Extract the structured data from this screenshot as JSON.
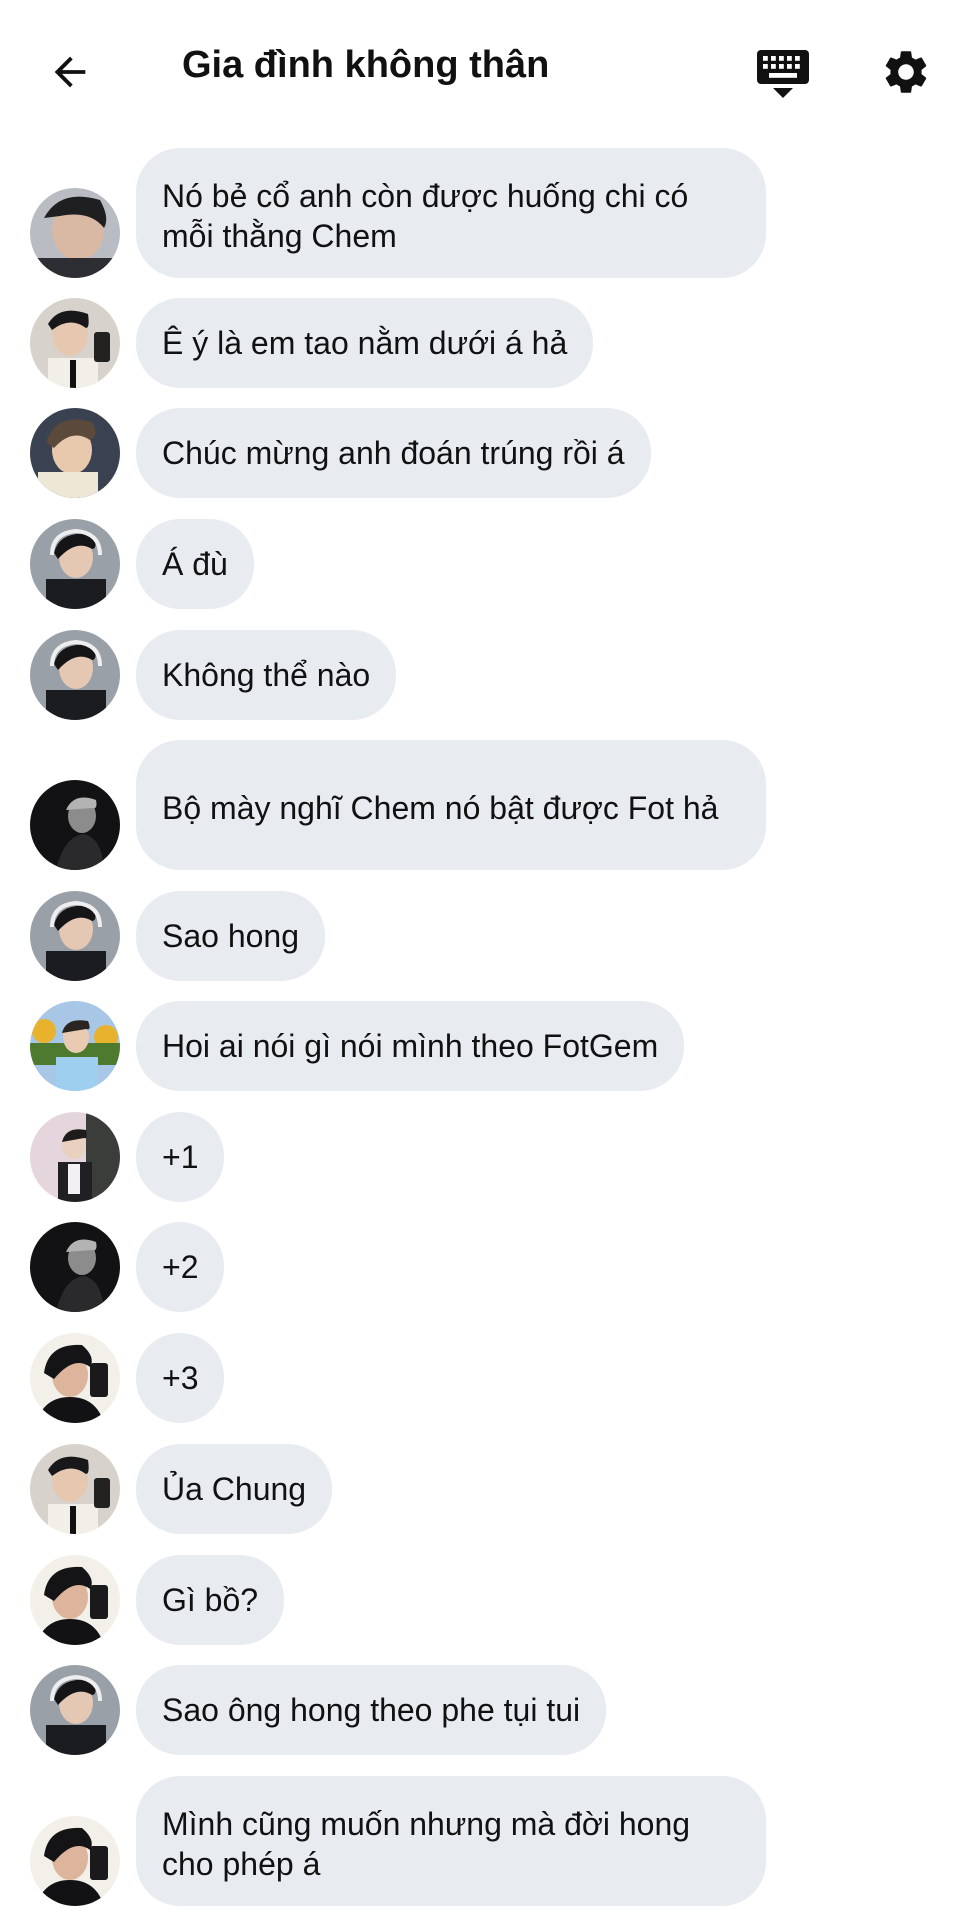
{
  "header": {
    "title": "Gia đình không thân",
    "back_icon": "arrow-left-icon",
    "keyboard_icon": "keyboard-hide-icon",
    "settings_icon": "gear-icon"
  },
  "colors": {
    "bubble_bg": "#e8ebf0",
    "text": "#111111",
    "background": "#ffffff"
  },
  "messages": [
    {
      "text": "Nó bẻ cổ anh còn được huống chi có mỗi thằng Chem"
    },
    {
      "text": "Ê ý là em tao nằm dưới á hả"
    },
    {
      "text": "Chúc mừng anh đoán trúng rồi á"
    },
    {
      "text": "Á đù"
    },
    {
      "text": "Không thể nào"
    },
    {
      "text": "Bộ mày nghĩ Chem nó bật được Fot hả"
    },
    {
      "text": "Sao hong"
    },
    {
      "text": "Hoi ai nói gì nói mình theo FotGem"
    },
    {
      "text": "+1"
    },
    {
      "text": "+2"
    },
    {
      "text": "+3"
    },
    {
      "text": "Ủa Chung"
    },
    {
      "text": "Gì bồ?"
    },
    {
      "text": "Sao ông hong theo phe tụi tui"
    },
    {
      "text": "Mình cũng muốn nhưng mà đời hong cho phép á"
    }
  ]
}
